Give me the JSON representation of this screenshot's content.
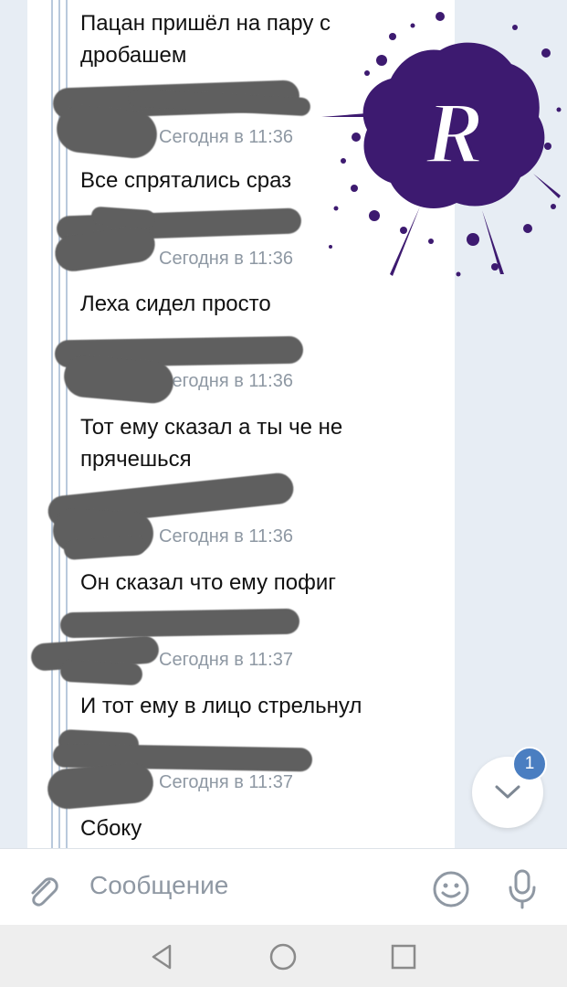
{
  "messages": [
    {
      "text": "Пацан пришёл на пару с дробашем",
      "time": "Сегодня в 11:36"
    },
    {
      "text": "Все спрятались сраз",
      "time": "Сегодня в 11:36"
    },
    {
      "text": "Леха сидел просто",
      "time": "Сегодня в 11:36"
    },
    {
      "text": "Тот ему сказал а ты че не прячешься",
      "time": "Сегодня в 11:36"
    },
    {
      "text": "Он сказал что ему пофиг",
      "time": "Сегодня в 11:37"
    },
    {
      "text": "И тот ему в лицо стрельнул",
      "time": "Сегодня в 11:37"
    },
    {
      "text": "Сбоку",
      "time": ""
    }
  ],
  "scroll_button": {
    "badge": "1"
  },
  "composer": {
    "placeholder": "Сообщение"
  },
  "icons": {
    "attach": "paperclip-icon",
    "emoji": "smiley-icon",
    "mic": "microphone-icon",
    "scroll_down": "chevron-down-icon",
    "nav_back": "triangle-back-icon",
    "nav_home": "circle-home-icon",
    "nav_recent": "square-recent-icon",
    "watermark": "ink-splash-logo"
  },
  "colors": {
    "accent": "#4a7ec1",
    "watermark": "#3d1a70",
    "redaction": "#5f5f5f"
  }
}
